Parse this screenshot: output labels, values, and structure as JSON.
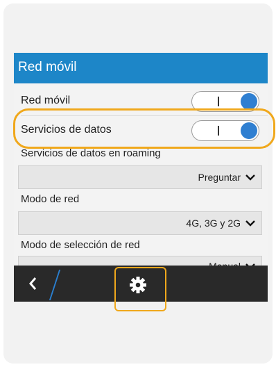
{
  "screen": {
    "title": "Red móvil"
  },
  "settings": {
    "mobile_network": {
      "label": "Red móvil",
      "state": "on"
    },
    "data_services": {
      "label": "Servicios de datos",
      "state": "on"
    },
    "roaming": {
      "label": "Servicios de datos en roaming",
      "value": "Preguntar"
    },
    "network_mode": {
      "label": "Modo de red",
      "value": "4G, 3G y 2G"
    },
    "network_selection": {
      "label": "Modo de selección de red",
      "value": "Manual"
    }
  },
  "toggle_glyph": "I",
  "icons": {
    "back": "back-chevron-icon",
    "settings": "gear-icon",
    "dropdown": "chevron-down-icon"
  },
  "colors": {
    "titlebar": "#1d86c8",
    "toggle_on": "#2f7fd1",
    "highlight": "#f0a81c",
    "bottombar": "#292929"
  }
}
